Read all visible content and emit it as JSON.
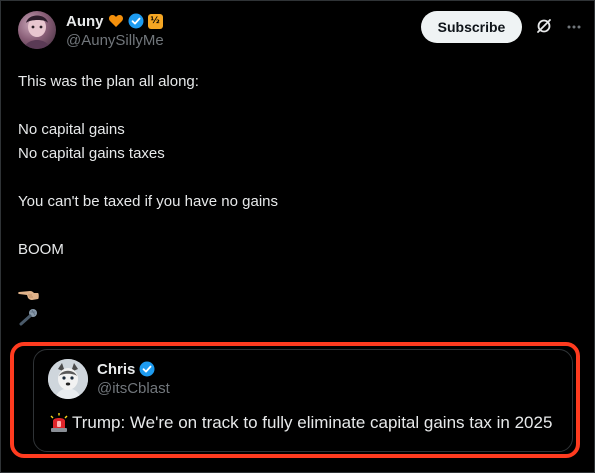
{
  "post": {
    "author": {
      "name": "Auny",
      "handle": "@AunySillyMe",
      "icons": [
        "orange-heart-icon",
        "verified-badge-icon",
        "affiliate-badge-icon"
      ],
      "badge_text": "½"
    },
    "subscribe_label": "Subscribe",
    "toolbar_icons": [
      "grok-icon",
      "more-icon"
    ],
    "text_lines": [
      "This was the plan all along:",
      "",
      "No capital gains",
      "No capital gains taxes",
      "",
      "You can't be taxed if you have no gains",
      "",
      "BOOM"
    ],
    "emojis": [
      "hand-pointing-left-icon",
      "microphone-icon"
    ]
  },
  "quote": {
    "author": {
      "name": "Chris",
      "handle": "@itsCblast",
      "icons": [
        "verified-badge-icon"
      ]
    },
    "siren_icon": "police-siren-icon",
    "text": "Trump: We're on track to fully eliminate capital gains tax in 2025"
  },
  "colors": {
    "background": "#000000",
    "text_primary": "#e7e9ea",
    "text_secondary": "#71767b",
    "verified_blue": "#1d9bf0",
    "highlight_outline": "#ff3b1f",
    "subscribe_bg": "#eff3f4"
  }
}
